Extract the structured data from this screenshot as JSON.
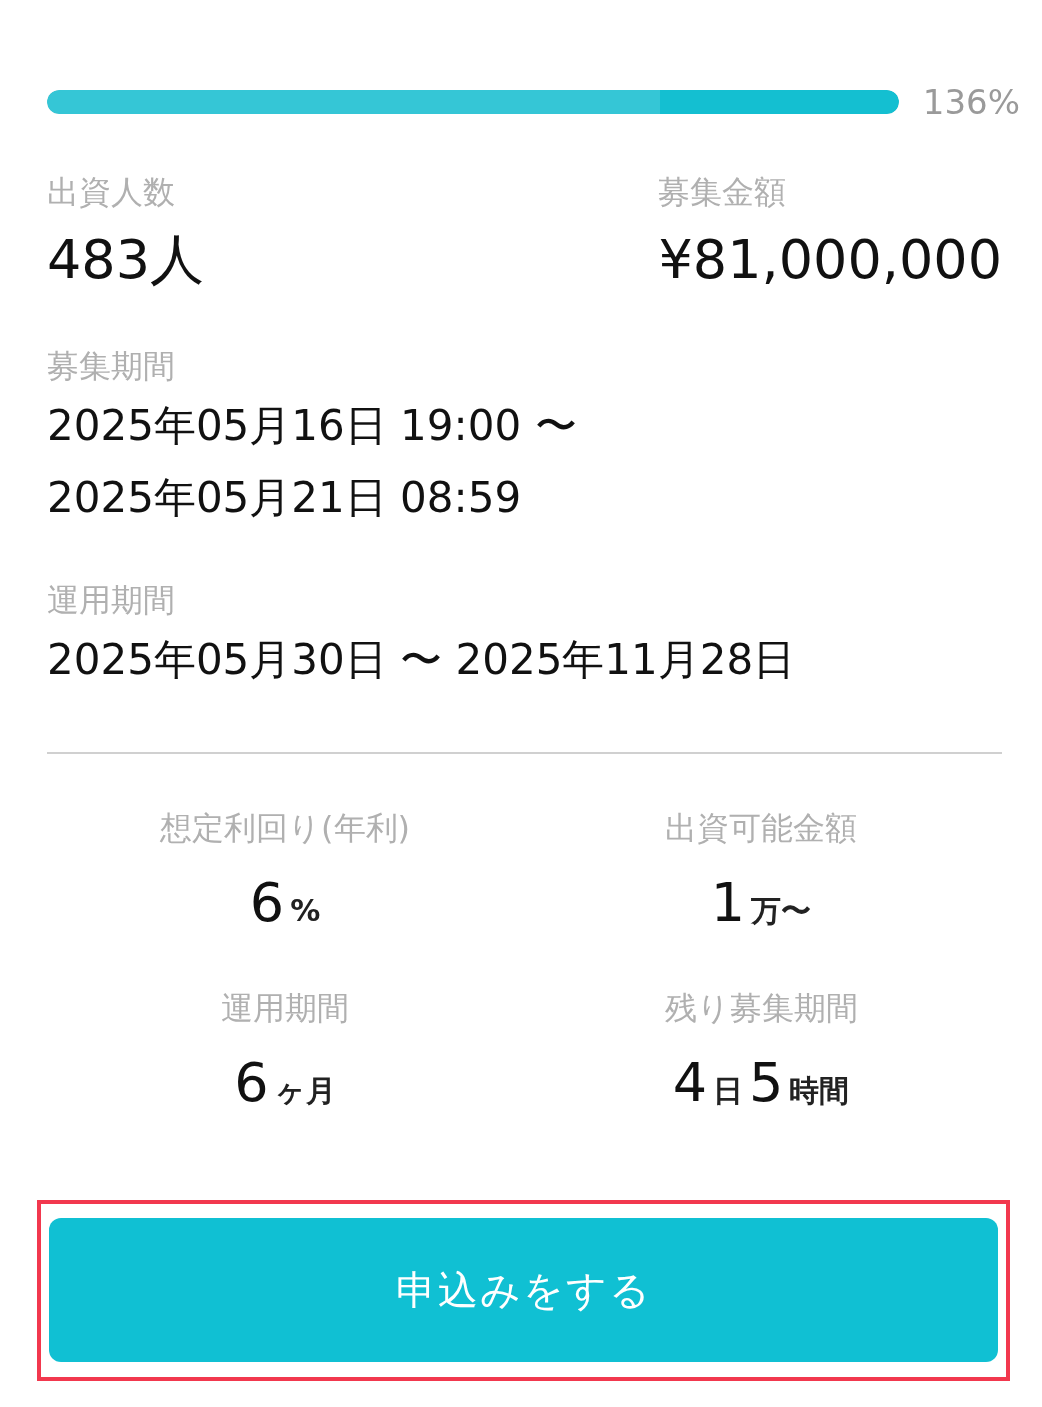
{
  "progress": {
    "level": 1,
    "reading": "136%"
  },
  "summary": [
    {
      "label": "出資人数",
      "value": "483人"
    },
    {
      "label": "募集金額",
      "value": "¥81,000,000"
    }
  ],
  "periods": [
    {
      "label": "募集期間",
      "lines": [
        "2025年05月16日 19:00 〜",
        "2025年05月21日 08:59"
      ]
    },
    {
      "label": "運用期間",
      "lines": [
        "2025年05月30日 〜 2025年11月28日"
      ]
    }
  ],
  "stats": [
    {
      "label": "想定利回り(年利)",
      "parts": [
        {
          "kind": "number",
          "text": "6"
        },
        {
          "kind": "unit",
          "text": "%"
        }
      ]
    },
    {
      "label": "出資可能金額",
      "parts": [
        {
          "kind": "number",
          "text": "1"
        },
        {
          "kind": "unit",
          "text": "万〜"
        }
      ]
    },
    {
      "label": "運用期間",
      "parts": [
        {
          "kind": "number",
          "text": "6"
        },
        {
          "kind": "unit",
          "text": "ヶ月"
        }
      ]
    },
    {
      "label": "残り募集期間",
      "parts": [
        {
          "kind": "number",
          "text": "4"
        },
        {
          "kind": "unit",
          "text": "日"
        },
        {
          "kind": "number",
          "text": "5"
        },
        {
          "kind": "unit",
          "text": "時間"
        }
      ]
    }
  ],
  "apply_button": {
    "label": "申込みをする",
    "highlighted": true
  }
}
